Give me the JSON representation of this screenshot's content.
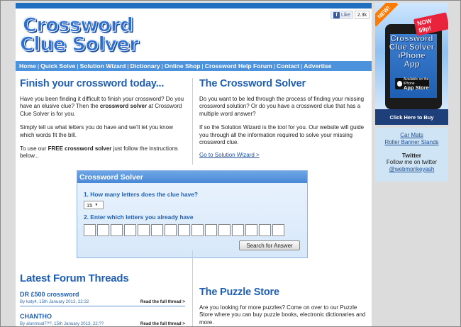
{
  "header": {
    "logo_line1": "Crossword",
    "logo_line2": "Clue Solver",
    "fb_like": "Like",
    "fb_count": "2.3k"
  },
  "nav": [
    "Home",
    "Quick Solve",
    "Solution Wizard",
    "Dictionary",
    "Online Shop",
    "Crossword Help Forum",
    "Contact",
    "Advertise"
  ],
  "nav_sep": "|",
  "left": {
    "title": "Finish your crossword today...",
    "p1_a": "Have you been finding it difficult to finish your crossword? Do you have an elusive clue? Then the ",
    "p1_b": "crossword solver",
    "p1_c": " at Crossword Clue Solver is for you.",
    "p2": "Simply tell us what letters you do have and we'll let you know which words fit the bill.",
    "p3_a": "To use our ",
    "p3_b": "FREE crossword solver",
    "p3_c": " just follow the instructions below..."
  },
  "right": {
    "title": "The Crossword Solver",
    "p1": "Do you want to be led through the process of finding your missing crossword solution? Or do you have a crossword clue that has a multiple word answer?",
    "p2": "If so the Solution Wizard is the tool for you. Our website will guide you through all the information required to solve your missing crossword clue.",
    "link": "Go to Solution Wizard >"
  },
  "solver": {
    "title": "Crossword Solver",
    "q1": "1. How many letters does the clue have?",
    "letters_value": "15",
    "q2": "2. Enter which letters you already have",
    "box_count": 15,
    "button": "Search for Answer"
  },
  "forum": {
    "title": "Latest Forum Threads",
    "threads": [
      {
        "title": "DR £500 crossword",
        "meta": "By katy4, 15th January 2013, 22:32",
        "read": "Read the full thread >"
      },
      {
        "title": "CHANTHO",
        "meta": "By alunmoat7??, 15th January 2013, 22:??",
        "read": "Read the full thread >"
      }
    ]
  },
  "puzzle": {
    "title": "The Puzzle Store",
    "p1": "Are you looking for more puzzles? Come on over to our Puzzle Store where you can buy puzzle books, electronic dictionaries and more."
  },
  "ad": {
    "new": "NEW!",
    "price": "NOW 59p!",
    "title_l1": "Crossword",
    "title_l2": "Clue Solver",
    "title_l3": "iPhone",
    "title_l4": "App",
    "store_small": "Available on the iPhone",
    "store_big": "App Store",
    "cta": "Click Here to Buy"
  },
  "sidebar": {
    "link1": "Car Mats",
    "link2": "Roller Banner Stands",
    "twitter_head": "Twitter",
    "twitter_text": "Follow me on twitter",
    "twitter_handle": "@webmonkeyash"
  }
}
